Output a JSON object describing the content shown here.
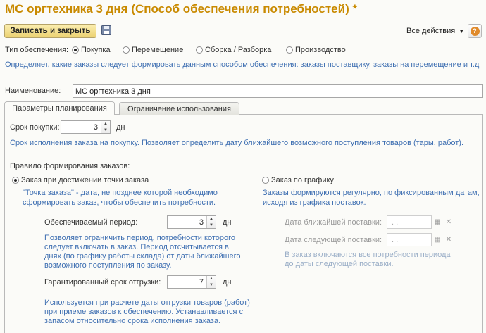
{
  "window": {
    "title": "МС оргтехника 3 дня (Способ обеспечения потребностей) *"
  },
  "toolbar": {
    "save_close_label": "Записать и закрыть",
    "all_actions_label": "Все действия",
    "help_label": "?"
  },
  "supply_type": {
    "label": "Тип обеспечения:",
    "options": [
      "Покупка",
      "Перемещение",
      "Сборка / Разборка",
      "Производство"
    ],
    "selected": "Покупка",
    "hint": "Определяет, какие заказы следует формировать данным способом обеспечения: заказы поставщику, заказы на перемещение и т.д"
  },
  "name_field": {
    "label": "Наименование:",
    "value": "МС оргтехника 3 дня"
  },
  "tabs": [
    {
      "label": "Параметры планирования"
    },
    {
      "label": "Ограничение использования"
    }
  ],
  "purchase_term": {
    "label": "Срок покупки:",
    "value": "3",
    "unit": "дн",
    "hint": "Срок исполнения заказа на покупку. Позволяет определить дату ближайшего возможного поступления товаров (тары, работ)."
  },
  "order_rule": {
    "label": "Правило формирования заказов:",
    "option_reorder": {
      "label": "Заказ при достижении точки заказа",
      "hint_line1": "\"Точка заказа\" - дата, не позднее которой необходимо",
      "hint_line2": "сформировать заказ, чтобы обеспечить потребности."
    },
    "option_schedule": {
      "label": "Заказ по графику",
      "hint_line1": "Заказы формируются регулярно, по фиксированным датам,",
      "hint_line2": "исходя из графика поставок."
    }
  },
  "provided_period": {
    "label": "Обеспечиваемый период:",
    "value": "3",
    "unit": "дн",
    "hint_lines": [
      "Позволяет ограничить период, потребности которого",
      "следует включать в заказ. Период отсчитывается в",
      "днях (по графику работы склада) от даты ближайшего",
      "возможного поступления по заказу."
    ]
  },
  "guaranteed_shipment": {
    "label": "Гарантированный срок отгрузки:",
    "value": "7",
    "unit": "дн",
    "hint_lines": [
      "Используется при расчете даты отгрузки товаров (работ)",
      "при приеме заказов к обеспечению. Устанавливается с",
      "запасом относительно срока исполнения заказа."
    ]
  },
  "next_delivery_date": {
    "label": "Дата ближайшей поставки:",
    "value": ".  ."
  },
  "following_delivery_date": {
    "label": "Дата следующей поставки:",
    "value": ".  ."
  },
  "schedule_hint_lines": [
    "В заказ включаются все потребности периода",
    "до даты следующей поставки."
  ],
  "colors": {
    "title": "#c98a00",
    "hint": "#3d6eb1",
    "muted_hint": "#9aaec7",
    "accent_button": "#ecd272"
  },
  "icons": {
    "save": "floppy-disk-icon",
    "help": "help-icon",
    "calendar": "calendar-icon",
    "clear": "clear-icon",
    "dropdown": "chevron-down-icon"
  }
}
